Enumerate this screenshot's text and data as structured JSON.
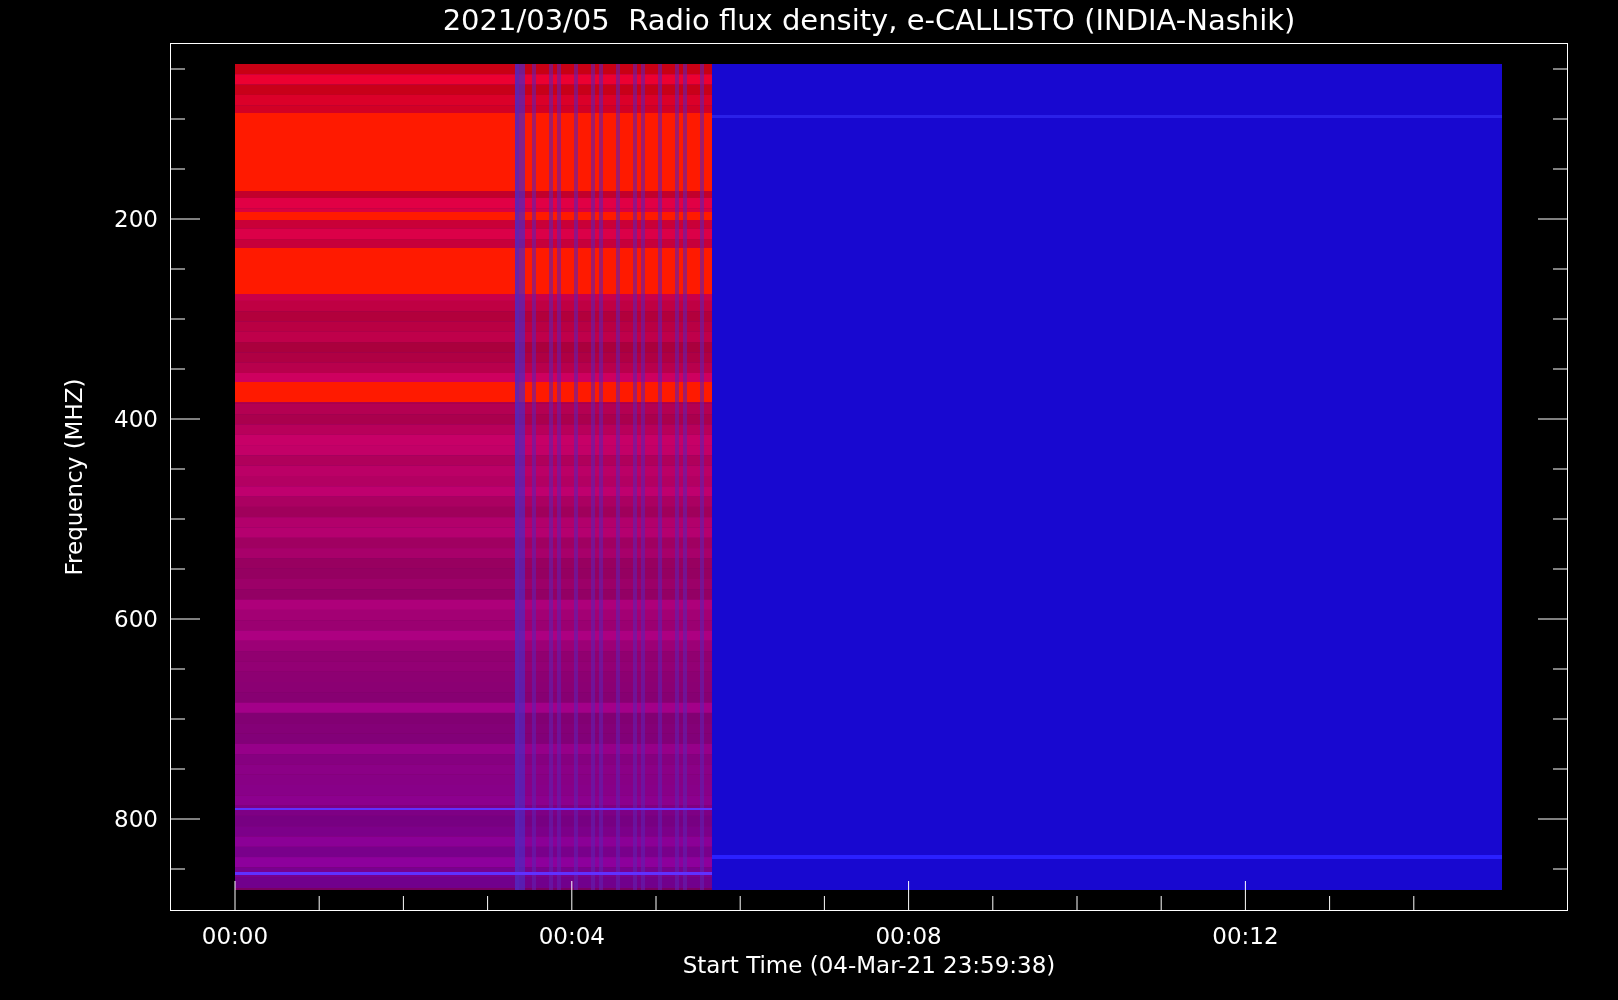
{
  "title": "2021/03/05  Radio flux density, e-CALLISTO (INDIA-Nashik)",
  "y_axis": {
    "label": "Frequency (MHZ)",
    "ticks": [
      "200",
      "400",
      "600",
      "800"
    ]
  },
  "x_axis": {
    "label": "Start Time (04-Mar-21 23:59:38)",
    "ticks": [
      "00:00",
      "00:04",
      "00:08",
      "00:12"
    ]
  }
}
